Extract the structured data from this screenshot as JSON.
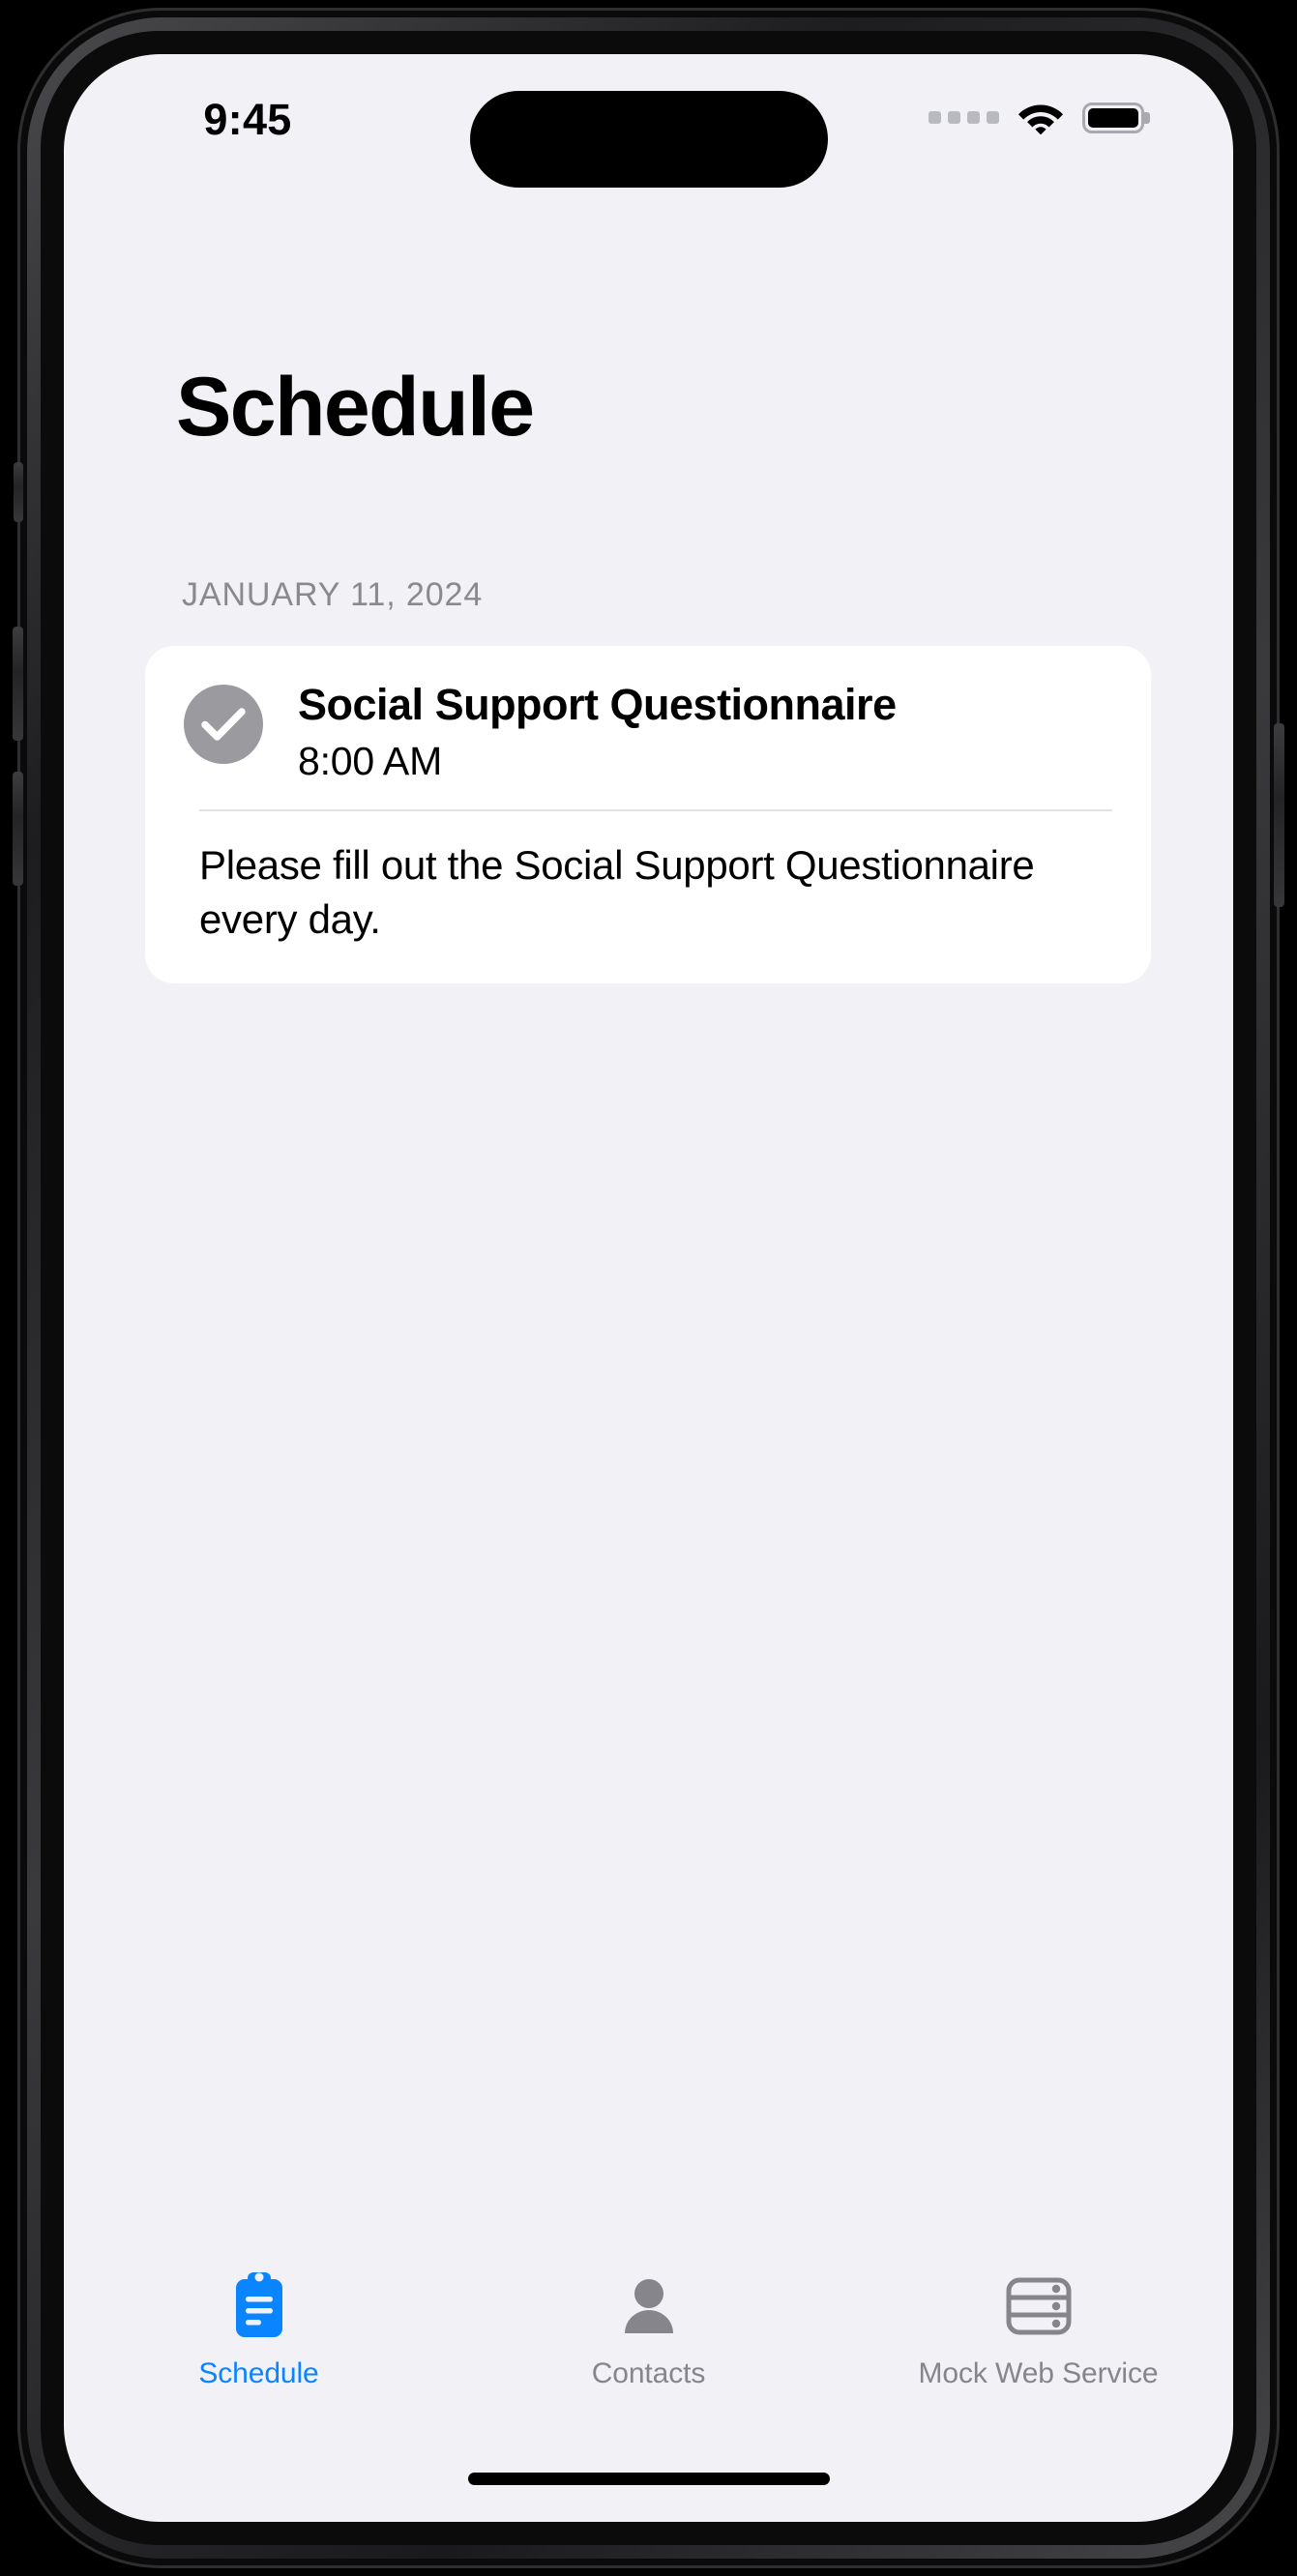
{
  "status_bar": {
    "time": "9:45",
    "cellular_icon": "cellular-dots-icon",
    "wifi_icon": "wifi-icon",
    "battery_icon": "battery-full-icon",
    "dynamic_island": "dynamic-island"
  },
  "header": {
    "title": "Schedule"
  },
  "schedule": {
    "date_label": "JANUARY 11, 2024",
    "tasks": [
      {
        "status_icon": "checkmark-circle-icon",
        "completed": true,
        "title": "Social Support Questionnaire",
        "time": "8:00 AM",
        "description": "Please fill out the Social Support Questionnaire every day."
      }
    ]
  },
  "tab_bar": {
    "items": [
      {
        "label": "Schedule",
        "icon": "clipboard-icon",
        "active": true
      },
      {
        "label": "Contacts",
        "icon": "person-icon",
        "active": false
      },
      {
        "label": "Mock Web Service",
        "icon": "server-rack-icon",
        "active": false
      }
    ]
  },
  "colors": {
    "accent": "#0A84FF",
    "background": "#F2F1F6",
    "card": "#FFFFFF",
    "inactive_tab": "#85858B",
    "badge_gray": "#9B9B9F",
    "secondary_text": "#8A8A8E"
  },
  "home_indicator": "home-indicator"
}
